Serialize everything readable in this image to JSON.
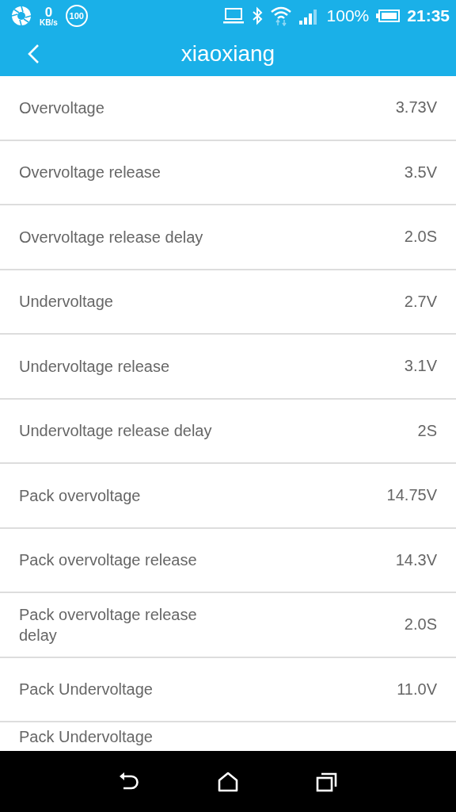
{
  "status_bar": {
    "speed_value": "0",
    "speed_unit": "KB/s",
    "badge": "100",
    "battery_text": "100%",
    "time": "21:35"
  },
  "app_bar": {
    "title": "xiaoxiang"
  },
  "settings": [
    {
      "label": "Overvoltage",
      "value": "3.73V"
    },
    {
      "label": "Overvoltage release",
      "value": "3.5V"
    },
    {
      "label": "Overvoltage release delay",
      "value": "2.0S"
    },
    {
      "label": "Undervoltage",
      "value": "2.7V"
    },
    {
      "label": "Undervoltage release",
      "value": "3.1V"
    },
    {
      "label": "Undervoltage release delay",
      "value": "2S"
    },
    {
      "label": "Pack overvoltage",
      "value": "14.75V"
    },
    {
      "label": "Pack overvoltage release",
      "value": "14.3V"
    },
    {
      "label": "Pack overvoltage release delay",
      "value": "2.0S"
    },
    {
      "label": "Pack Undervoltage",
      "value": "11.0V"
    },
    {
      "label": "Pack Undervoltage"
    }
  ]
}
